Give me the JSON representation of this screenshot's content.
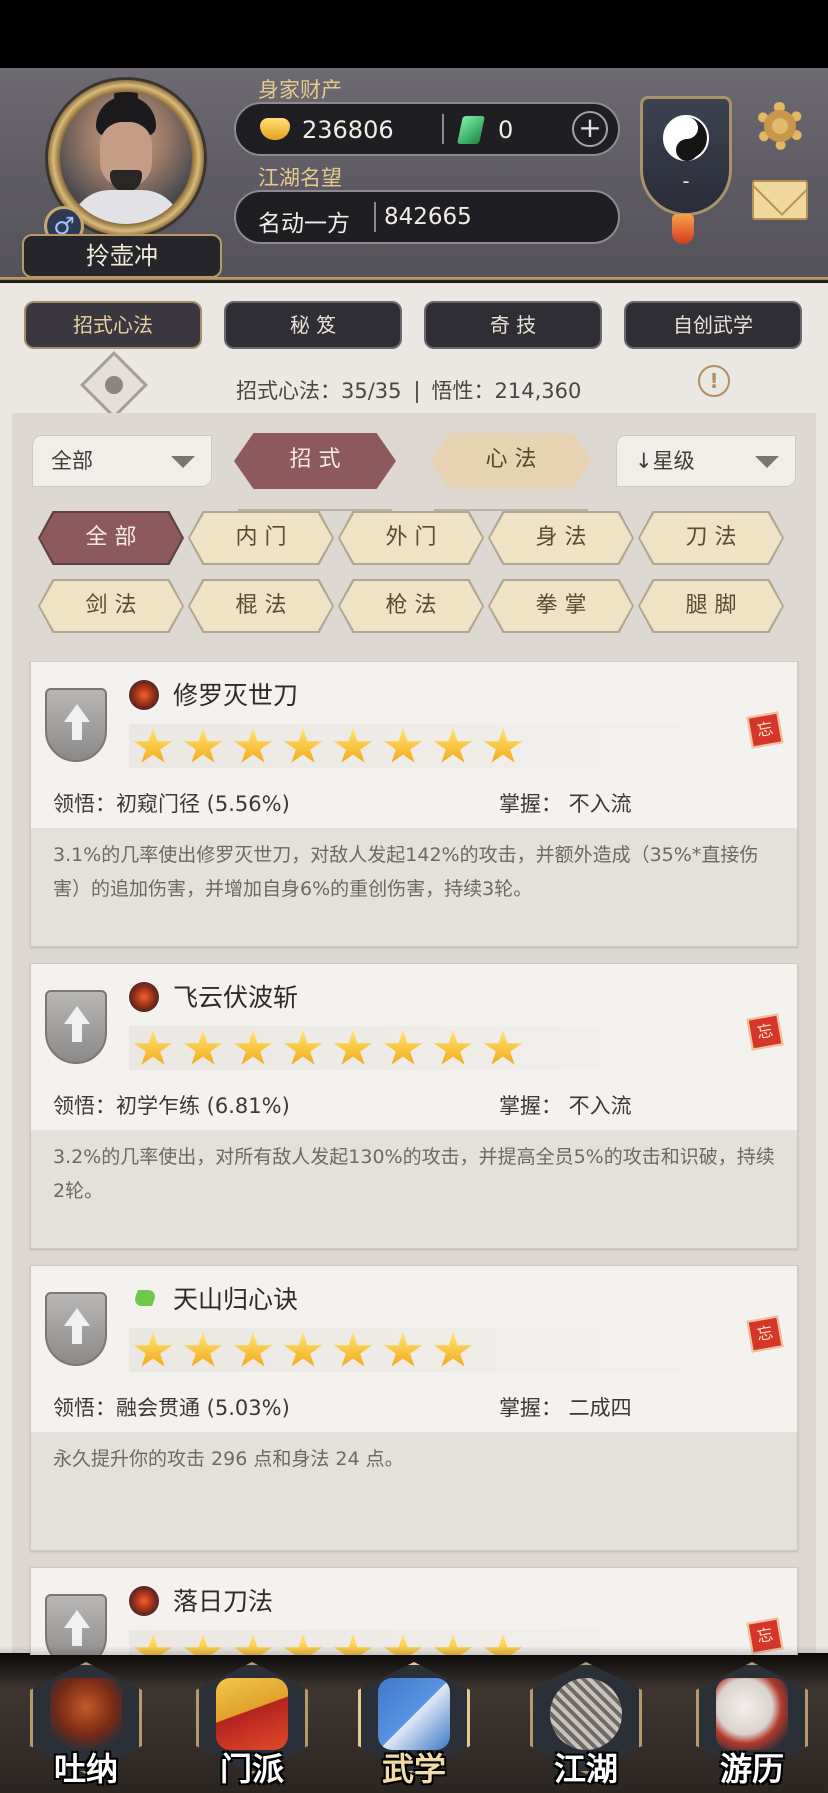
{
  "header": {
    "player_name": "拎壶冲",
    "gender_symbol": "♂",
    "wealth_label": "身家财产",
    "gold": "236806",
    "jade": "0",
    "plus": "+",
    "fame_label": "江湖名望",
    "fame_title": "名动一方",
    "fame_value": "842665",
    "faction_level": "-"
  },
  "tabs": [
    {
      "label": "招式心法",
      "active": true
    },
    {
      "label": "秘 笈",
      "active": false
    },
    {
      "label": "奇 技",
      "active": false
    },
    {
      "label": "自创武学",
      "active": false
    }
  ],
  "summary": {
    "moves": "招式心法：35/35",
    "insight": "悟性：214,360",
    "info": "!"
  },
  "filters": {
    "category_dropdown": "全部",
    "segments": [
      {
        "label": "招 式",
        "active": true
      },
      {
        "label": "心 法",
        "active": false
      }
    ],
    "sort_dropdown": "星级",
    "sort_arrow": "↓"
  },
  "chips": [
    {
      "label": "全 部",
      "active": true
    },
    {
      "label": "内 门",
      "active": false
    },
    {
      "label": "外 门",
      "active": false
    },
    {
      "label": "身 法",
      "active": false
    },
    {
      "label": "刀 法",
      "active": false
    },
    {
      "label": "剑 法",
      "active": false
    },
    {
      "label": "棍 法",
      "active": false
    },
    {
      "label": "枪 法",
      "active": false
    },
    {
      "label": "拳 掌",
      "active": false
    },
    {
      "label": "腿 脚",
      "active": false
    }
  ],
  "skills": [
    {
      "name": "修罗灭世刀",
      "stars": 8,
      "lingwu": "领悟：初窥门径 (5.56%)",
      "zhangwo": "掌握： 不入流",
      "desc": "3.1%的几率使出修罗灭世刀，对敌人发起142%的攻击，并额外造成（35%*直接伤害）的追加伤害，并增加自身6%的重创伤害，持续3轮。",
      "forget": "忘"
    },
    {
      "name": "飞云伏波斩",
      "stars": 8,
      "lingwu": "领悟：初学乍练 (6.81%)",
      "zhangwo": "掌握： 不入流",
      "desc": "3.2%的几率使出，对所有敌人发起130%的攻击，并提高全员5%的攻击和识破，持续2轮。",
      "forget": "忘"
    },
    {
      "name": "天山归心诀",
      "stars": 7,
      "lingwu": "领悟：融会贯通 (5.03%)",
      "zhangwo": "掌握： 二成四",
      "desc": "永久提升你的攻击 296 点和身法 24 点。",
      "forget": "忘"
    },
    {
      "name": "落日刀法",
      "stars": 8,
      "lingwu": "",
      "zhangwo": "",
      "desc": "",
      "forget": "忘"
    }
  ],
  "bottom_nav": [
    {
      "label": "吐纳",
      "active": false
    },
    {
      "label": "门派",
      "active": false
    },
    {
      "label": "武学",
      "active": true
    },
    {
      "label": "江湖",
      "active": false
    },
    {
      "label": "游历",
      "active": false
    }
  ]
}
